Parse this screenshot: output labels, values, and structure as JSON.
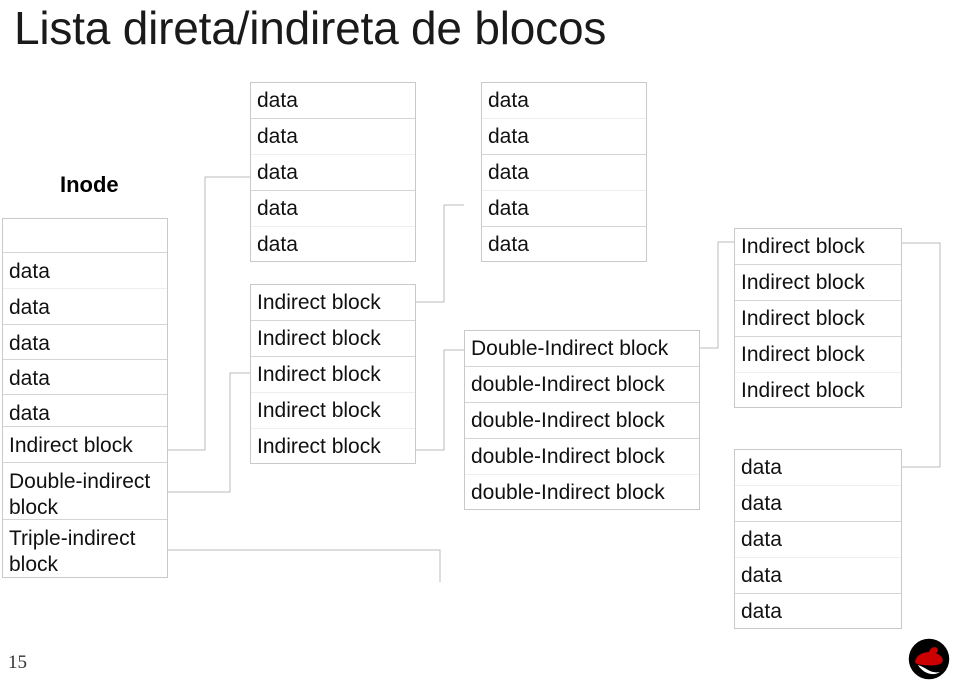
{
  "slide": {
    "title": "Lista direta/indireta de blocos",
    "page_number": "15",
    "logo_name": "red-hat-shadowman-logo"
  },
  "inode": {
    "label": "Inode",
    "rows": [
      "",
      "data",
      "data",
      "data",
      "data",
      "data",
      "Indirect block",
      "Double-indirect block",
      "Triple-indirect block"
    ]
  },
  "level1_data": {
    "rows": [
      "data",
      "data",
      "data",
      "data",
      "data"
    ]
  },
  "level1_indirect": {
    "rows": [
      "Indirect block",
      "Indirect block",
      "Indirect block",
      "Indirect block",
      "Indirect block"
    ]
  },
  "level2_data": {
    "rows": [
      "data",
      "data",
      "data",
      "data",
      "data"
    ]
  },
  "level2_double": {
    "rows": [
      "Double-Indirect block",
      "double-Indirect block",
      "double-Indirect block",
      "double-Indirect block",
      "double-Indirect block"
    ]
  },
  "level3_indirect": {
    "rows": [
      "Indirect block",
      "Indirect block",
      "Indirect block",
      "Indirect block",
      "Indirect block"
    ]
  },
  "level3_data": {
    "rows": [
      "data",
      "data",
      "data",
      "data",
      "data"
    ]
  },
  "colors": {
    "text": "#111111",
    "title": "#1a1a1a",
    "border": "#c9c9c9",
    "row_divider": "#d5d5d5",
    "wire": "#bbbbbb",
    "logo_red": "#cc0000",
    "logo_black": "#000000",
    "background": "#ffffff"
  }
}
